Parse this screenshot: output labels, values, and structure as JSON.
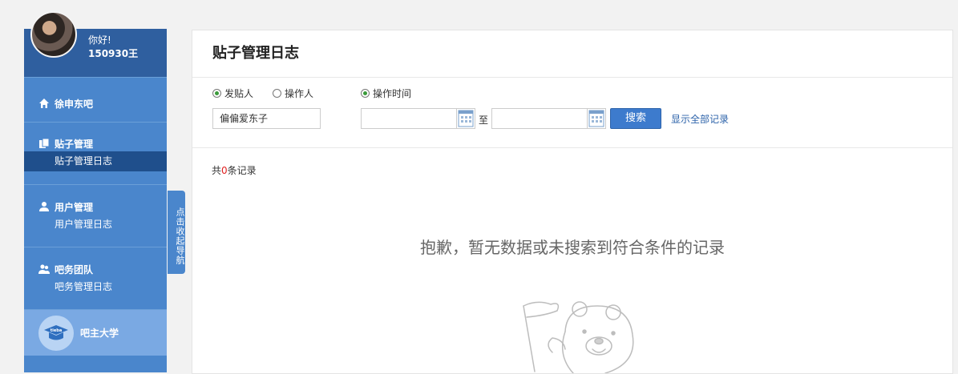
{
  "user": {
    "greeting": "你好!",
    "name": "150930王"
  },
  "sidebar": {
    "forum": {
      "label": "徐申东吧",
      "icon": "home-icon"
    },
    "sections": [
      {
        "title": "贴子管理",
        "icon": "document-icon",
        "sub": "贴子管理日志",
        "active": true
      },
      {
        "title": "用户管理",
        "icon": "user-icon",
        "sub": "用户管理日志",
        "active": false
      },
      {
        "title": "吧务团队",
        "icon": "group-icon",
        "sub": "吧务管理日志",
        "active": false
      }
    ],
    "college": {
      "label": "吧主大学",
      "icon": "graduation-cap-icon",
      "badge": "tieba"
    },
    "toggle_label": "点击收起导航"
  },
  "main": {
    "title": "贴子管理日志",
    "filters": {
      "poster_label": "发贴人",
      "operator_label": "操作人",
      "time_label": "操作时间",
      "name_value": "偏偏爱东子",
      "date_from": "",
      "date_to": "",
      "to_label": "至",
      "search_label": "搜索",
      "show_all_label": "显示全部记录"
    },
    "count": {
      "prefix": "共",
      "value": "0",
      "suffix": "条记录"
    },
    "empty_message": "抱歉，暂无数据或未搜索到符合条件的记录"
  },
  "colors": {
    "sidebar": "#4a86cc",
    "active": "#1f4f8c",
    "button": "#3d7bcd",
    "count": "#e02020"
  }
}
